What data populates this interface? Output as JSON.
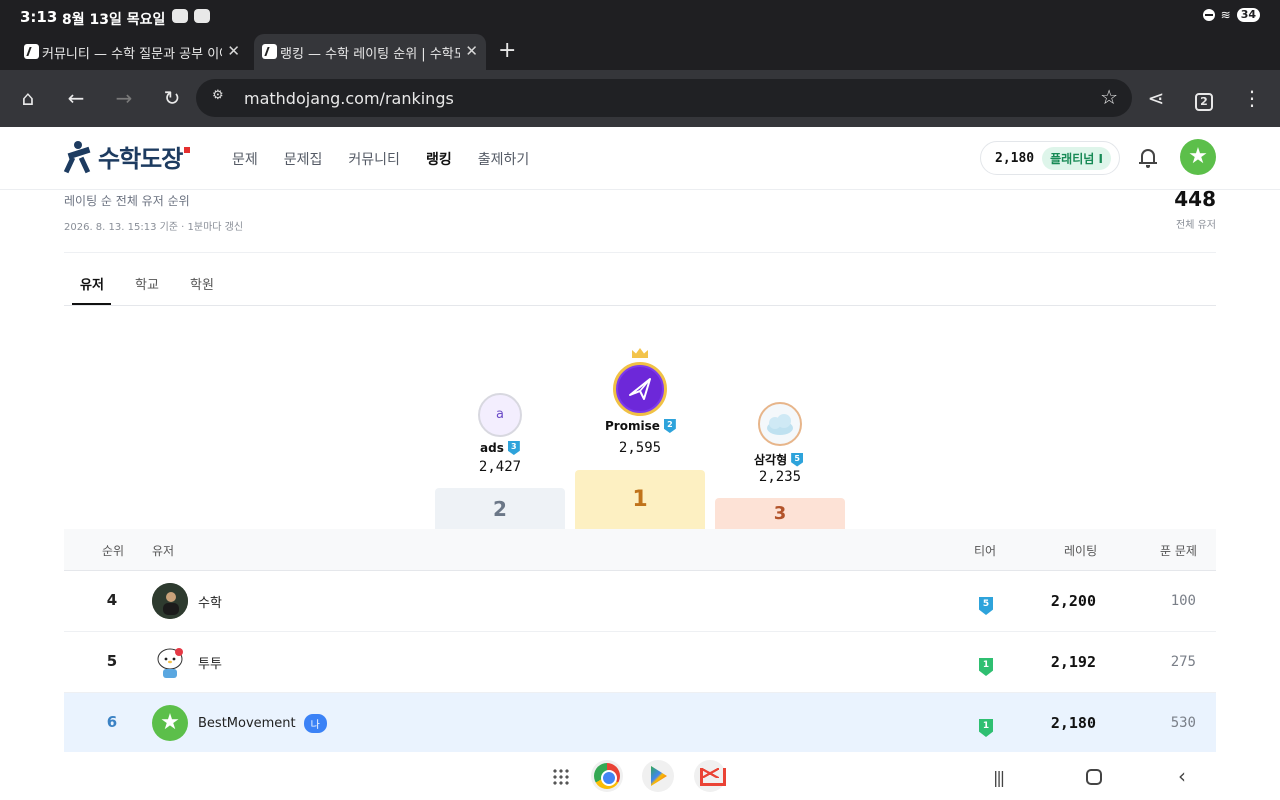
{
  "status_bar": {
    "time": "3:13",
    "date": "8월 13일 목요일",
    "battery": "34"
  },
  "browser": {
    "tabs": [
      {
        "title": "커뮤니티 — 수학 질문과 공부 이야기"
      },
      {
        "title": "랭킹 — 수학 레이팅 순위 | 수학도장"
      }
    ],
    "url": "mathdojang.com/rankings",
    "tab_count": "2"
  },
  "site": {
    "logo_text": "수학도장",
    "nav": [
      "문제",
      "문제집",
      "커뮤니티",
      "랭킹",
      "출제하기"
    ],
    "user_rating": "2,180",
    "user_tier": "플래티넘 I"
  },
  "page": {
    "subtitle": "레이팅 순 전체 유저 순위",
    "updated": "2026. 8. 13. 15:13 기준 · 1분마다 갱신",
    "total_users": "448",
    "total_label": "전체 유저",
    "tabs": [
      "유저",
      "학교",
      "학원"
    ]
  },
  "podium": [
    {
      "place": "2",
      "name": "ads",
      "initial": "a",
      "tier": "3",
      "rating": "2,427"
    },
    {
      "place": "1",
      "name": "Promise",
      "tier": "2",
      "rating": "2,595"
    },
    {
      "place": "3",
      "name": "삼각형",
      "tier": "5",
      "rating": "2,235"
    }
  ],
  "table": {
    "headers": {
      "rank": "순위",
      "user": "유저",
      "tier": "티어",
      "rating": "레이팅",
      "solved": "푼 문제"
    },
    "rows": [
      {
        "rank": "4",
        "name": "수학",
        "tier": "5",
        "rating": "2,200",
        "solved": "100"
      },
      {
        "rank": "5",
        "name": "투투",
        "tier": "1",
        "rating": "2,192",
        "solved": "275"
      },
      {
        "rank": "6",
        "name": "BestMovement",
        "me_label": "나",
        "tier": "1",
        "rating": "2,180",
        "solved": "530"
      }
    ]
  },
  "colors": {
    "brand": "#1d3b60",
    "accent_green": "#5cbf4a",
    "highlight_row": "#eaf3fe",
    "gold_block": "#fdf0c2"
  }
}
